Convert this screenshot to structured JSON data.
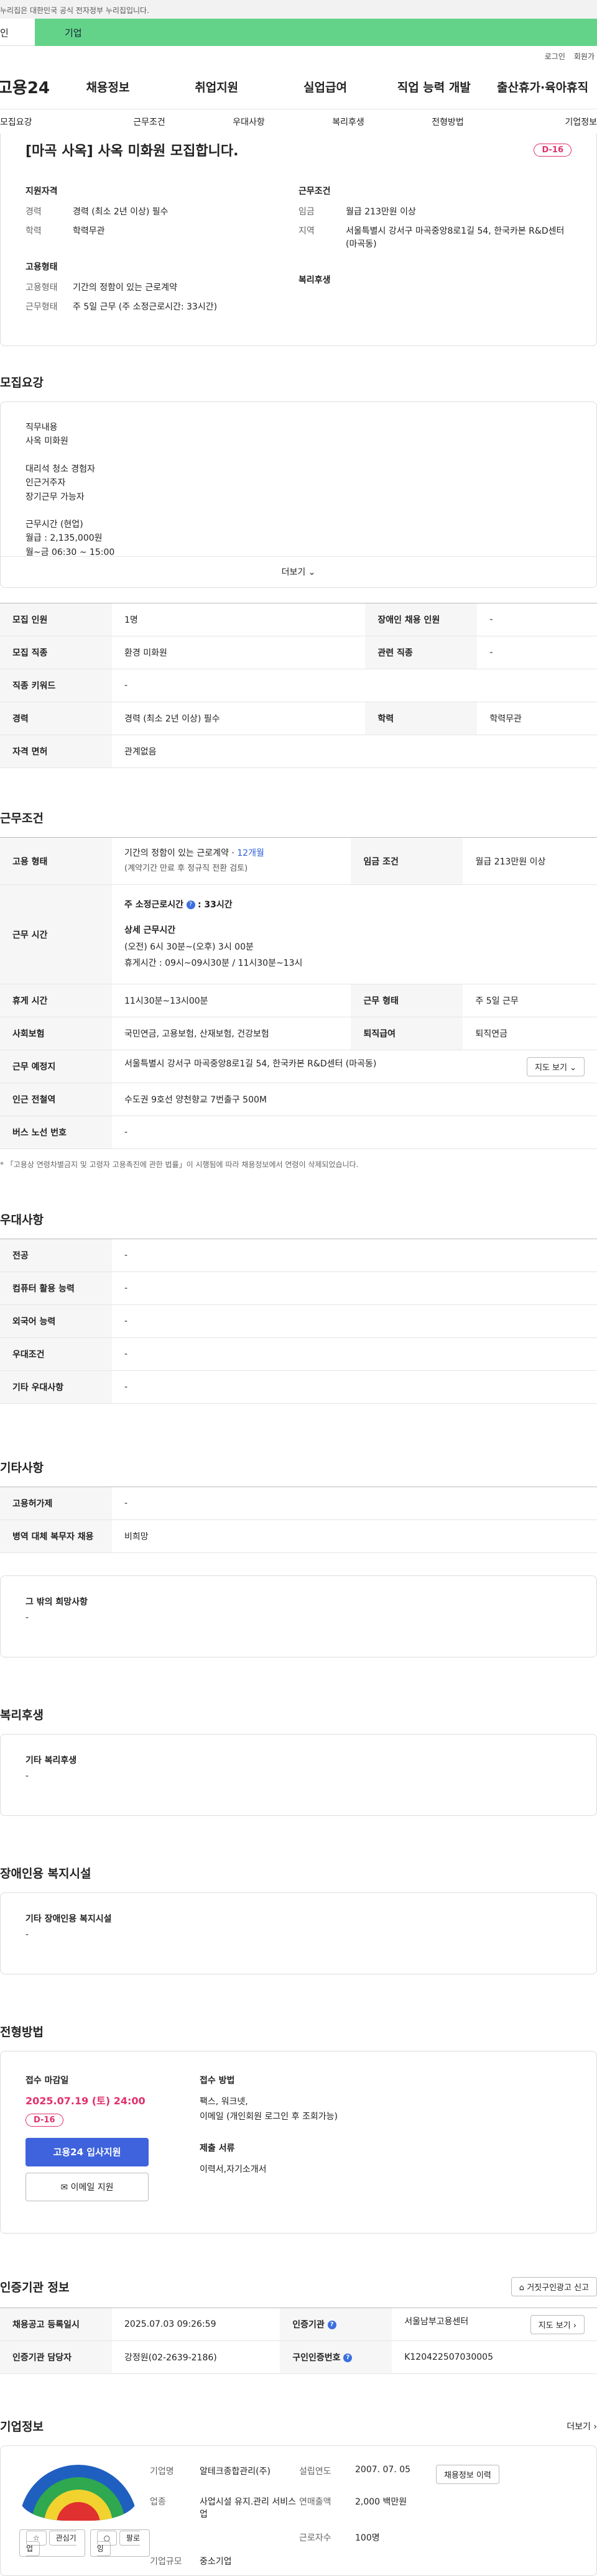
{
  "gov_notice": "누리집은 대한민국 공식 전자정부 누리집입니다.",
  "top_tabs": [
    "인",
    "기업"
  ],
  "util": [
    "로그인",
    "회원가"
  ],
  "gnb": {
    "logo": "고용24",
    "items": [
      "채용정보",
      "취업지원",
      "실업급여",
      "직업 능력 개발",
      "출산휴가·육아휴직"
    ]
  },
  "subnav": [
    "모집요강",
    "근무조건",
    "우대사항",
    "복리후생",
    "전형방법",
    "기업정보"
  ],
  "summary": {
    "title": "[마곡 사옥] 사옥 미화원 모집합니다.",
    "dday": "D-16",
    "qual_title": "지원자격",
    "career_k": "경력",
    "career_v": "경력 (최소 2년 이상) 필수",
    "edu_k": "학력",
    "edu_v": "학력무관",
    "emp_title": "고용형태",
    "emptype_k": "고용형태",
    "emptype_v": "기간의 정함이 있는 근로계약",
    "worktype_k": "근무형태",
    "worktype_v": "주 5일 근무 (주 소정근로시간: 33시간)",
    "cond_title": "근무조건",
    "wage_k": "임금",
    "wage_v": "월급 213만원 이상",
    "region_k": "지역",
    "region_v": "서울특별시 강서구 마곡중앙8로1길 54, 한국카본 R&D센터 (마곡동)",
    "welfare_title": "복리후생"
  },
  "recruit": {
    "title": "모집요강",
    "detail_lines": [
      "직무내용",
      "사옥 미화원",
      "",
      "대리석 청소 경험자",
      "인근거주자",
      "장기근무 가능자",
      "",
      "근무시간 (현업)",
      "월급 : 2,135,000원",
      "월~금  06:30 ~ 15:00"
    ],
    "more": "더보기",
    "rows": [
      {
        "k1": "모집 인원",
        "v1": "1명",
        "k2": "장애인 채용 인원",
        "v2": "-"
      },
      {
        "k1": "모집 직종",
        "v1": "환경 미화원",
        "k2": "관련 직종",
        "v2": "-"
      },
      {
        "k1": "직종 키워드",
        "v1": "-"
      },
      {
        "k1": "경력",
        "v1": "경력 (최소 2년 이상) 필수",
        "k2": "학력",
        "v2": "학력무관"
      },
      {
        "k1": "자격 면허",
        "v1": "관계없음"
      }
    ]
  },
  "work": {
    "title": "근무조건",
    "emp_k": "고용 형태",
    "emp_v1": "기간의 정함이 있는 근로계약 · ",
    "emp_v1b": "12개월",
    "emp_v2": "(계약기간 만료 후 정규직 전환 검토)",
    "wage_k": "임금 조건",
    "wage_v": "월급 213만원 이상",
    "time_k": "근무 시간",
    "time_h": "주 소정근로시간",
    "time_q": "?",
    "time_hv": ": 33시간",
    "time_detail_t": "상세 근무시간",
    "time_d1": "(오전) 6시 30분~(오후) 3시 00분",
    "time_d2": "휴게시간 : 09시~09시30분 / 11시30분~13시",
    "rest_k": "휴게 시간",
    "rest_v": "11시30분~13시00분",
    "form_k": "근무 형태",
    "form_v": "주 5일 근무",
    "ins_k": "사회보험",
    "ins_v": "국민연금, 고용보험, 산재보험, 건강보험",
    "ret_k": "퇴직급여",
    "ret_v": "퇴직연금",
    "place_k": "근무 예정지",
    "place_v": "서울특별시 강서구 마곡중앙8로1길 54, 한국카본 R&D센터 (마곡동)",
    "map_btn": "지도 보기",
    "subway_k": "인근 전철역",
    "subway_v": "수도권 9호선 양천향교 7번출구 500M",
    "bus_k": "버스 노선 번호",
    "bus_v": "-",
    "note": "* 「고용상 연령차별금지 및 고령자 고용촉진에 관한 법률」이 시행됨에 따라 채용정보에서 연령이 삭제되었습니다."
  },
  "pref": {
    "title": "우대사항",
    "rows": [
      {
        "k": "전공",
        "v": "-"
      },
      {
        "k": "컴퓨터 활용 능력",
        "v": "-"
      },
      {
        "k": "외국어 능력",
        "v": "-"
      },
      {
        "k": "우대조건",
        "v": "-"
      },
      {
        "k": "기타 우대사항",
        "v": "-"
      }
    ]
  },
  "etc": {
    "title": "기타사항",
    "rows": [
      {
        "k": "고용허가제",
        "v": "-"
      },
      {
        "k": "병역 대체 복무자 채용",
        "v": "비희망"
      }
    ],
    "box_title": "그 밖의 희망사항",
    "box_v": "-"
  },
  "welfare": {
    "title": "복리후생",
    "box_title": "기타 복리후생",
    "box_v": "-"
  },
  "disability": {
    "title": "장애인용 복지시설",
    "box_title": "기타 장애인용 복지시설",
    "box_v": "-"
  },
  "process": {
    "title": "전형방법",
    "deadline_t": "접수 마감일",
    "deadline_v": "2025.07.19 (토) 24:00",
    "dday": "D-16",
    "apply_btn": "고용24 입사지원",
    "email_btn": "이메일 지원",
    "method_t": "접수 방법",
    "method_v1": "팩스, 워크넷,",
    "method_v2": "이메일 (개인회원 로그인 후 조회가능)",
    "docs_t": "제출 서류",
    "docs_v": "이력서,자기소개서"
  },
  "agency": {
    "title": "인증기관 정보",
    "report_btn": "거짓구인광고 신고",
    "reg_k": "채용공고 등록일시",
    "reg_v": "2025.07.03 09:26:59",
    "org_k": "인증기관",
    "org_v": "서울남부고용센터",
    "map_btn": "지도 보기",
    "mgr_k": "인증기관 담당자",
    "mgr_v": "강정원(02-2639-2186)",
    "id_k": "구인인증번호",
    "id_v": "K120422507030005"
  },
  "company": {
    "title": "기업정보",
    "more": "더보기",
    "interest_btn": "관심기업",
    "follow_btn": "팔로잉",
    "name_k": "기업명",
    "name_v": "알테크종합관리(주)",
    "year_k": "설립연도",
    "year_v": "2007. 07. 05",
    "jobs_btn": "채용정보 이력",
    "biz_k": "업종",
    "biz_v": "사업시설 유지.관리 서비스업",
    "sales_k": "연매출액",
    "sales_v": "2,000 백만원",
    "emp_k": "근로자수",
    "emp_v": "100명",
    "size_k": "기업규모",
    "size_v": "중소기업"
  }
}
